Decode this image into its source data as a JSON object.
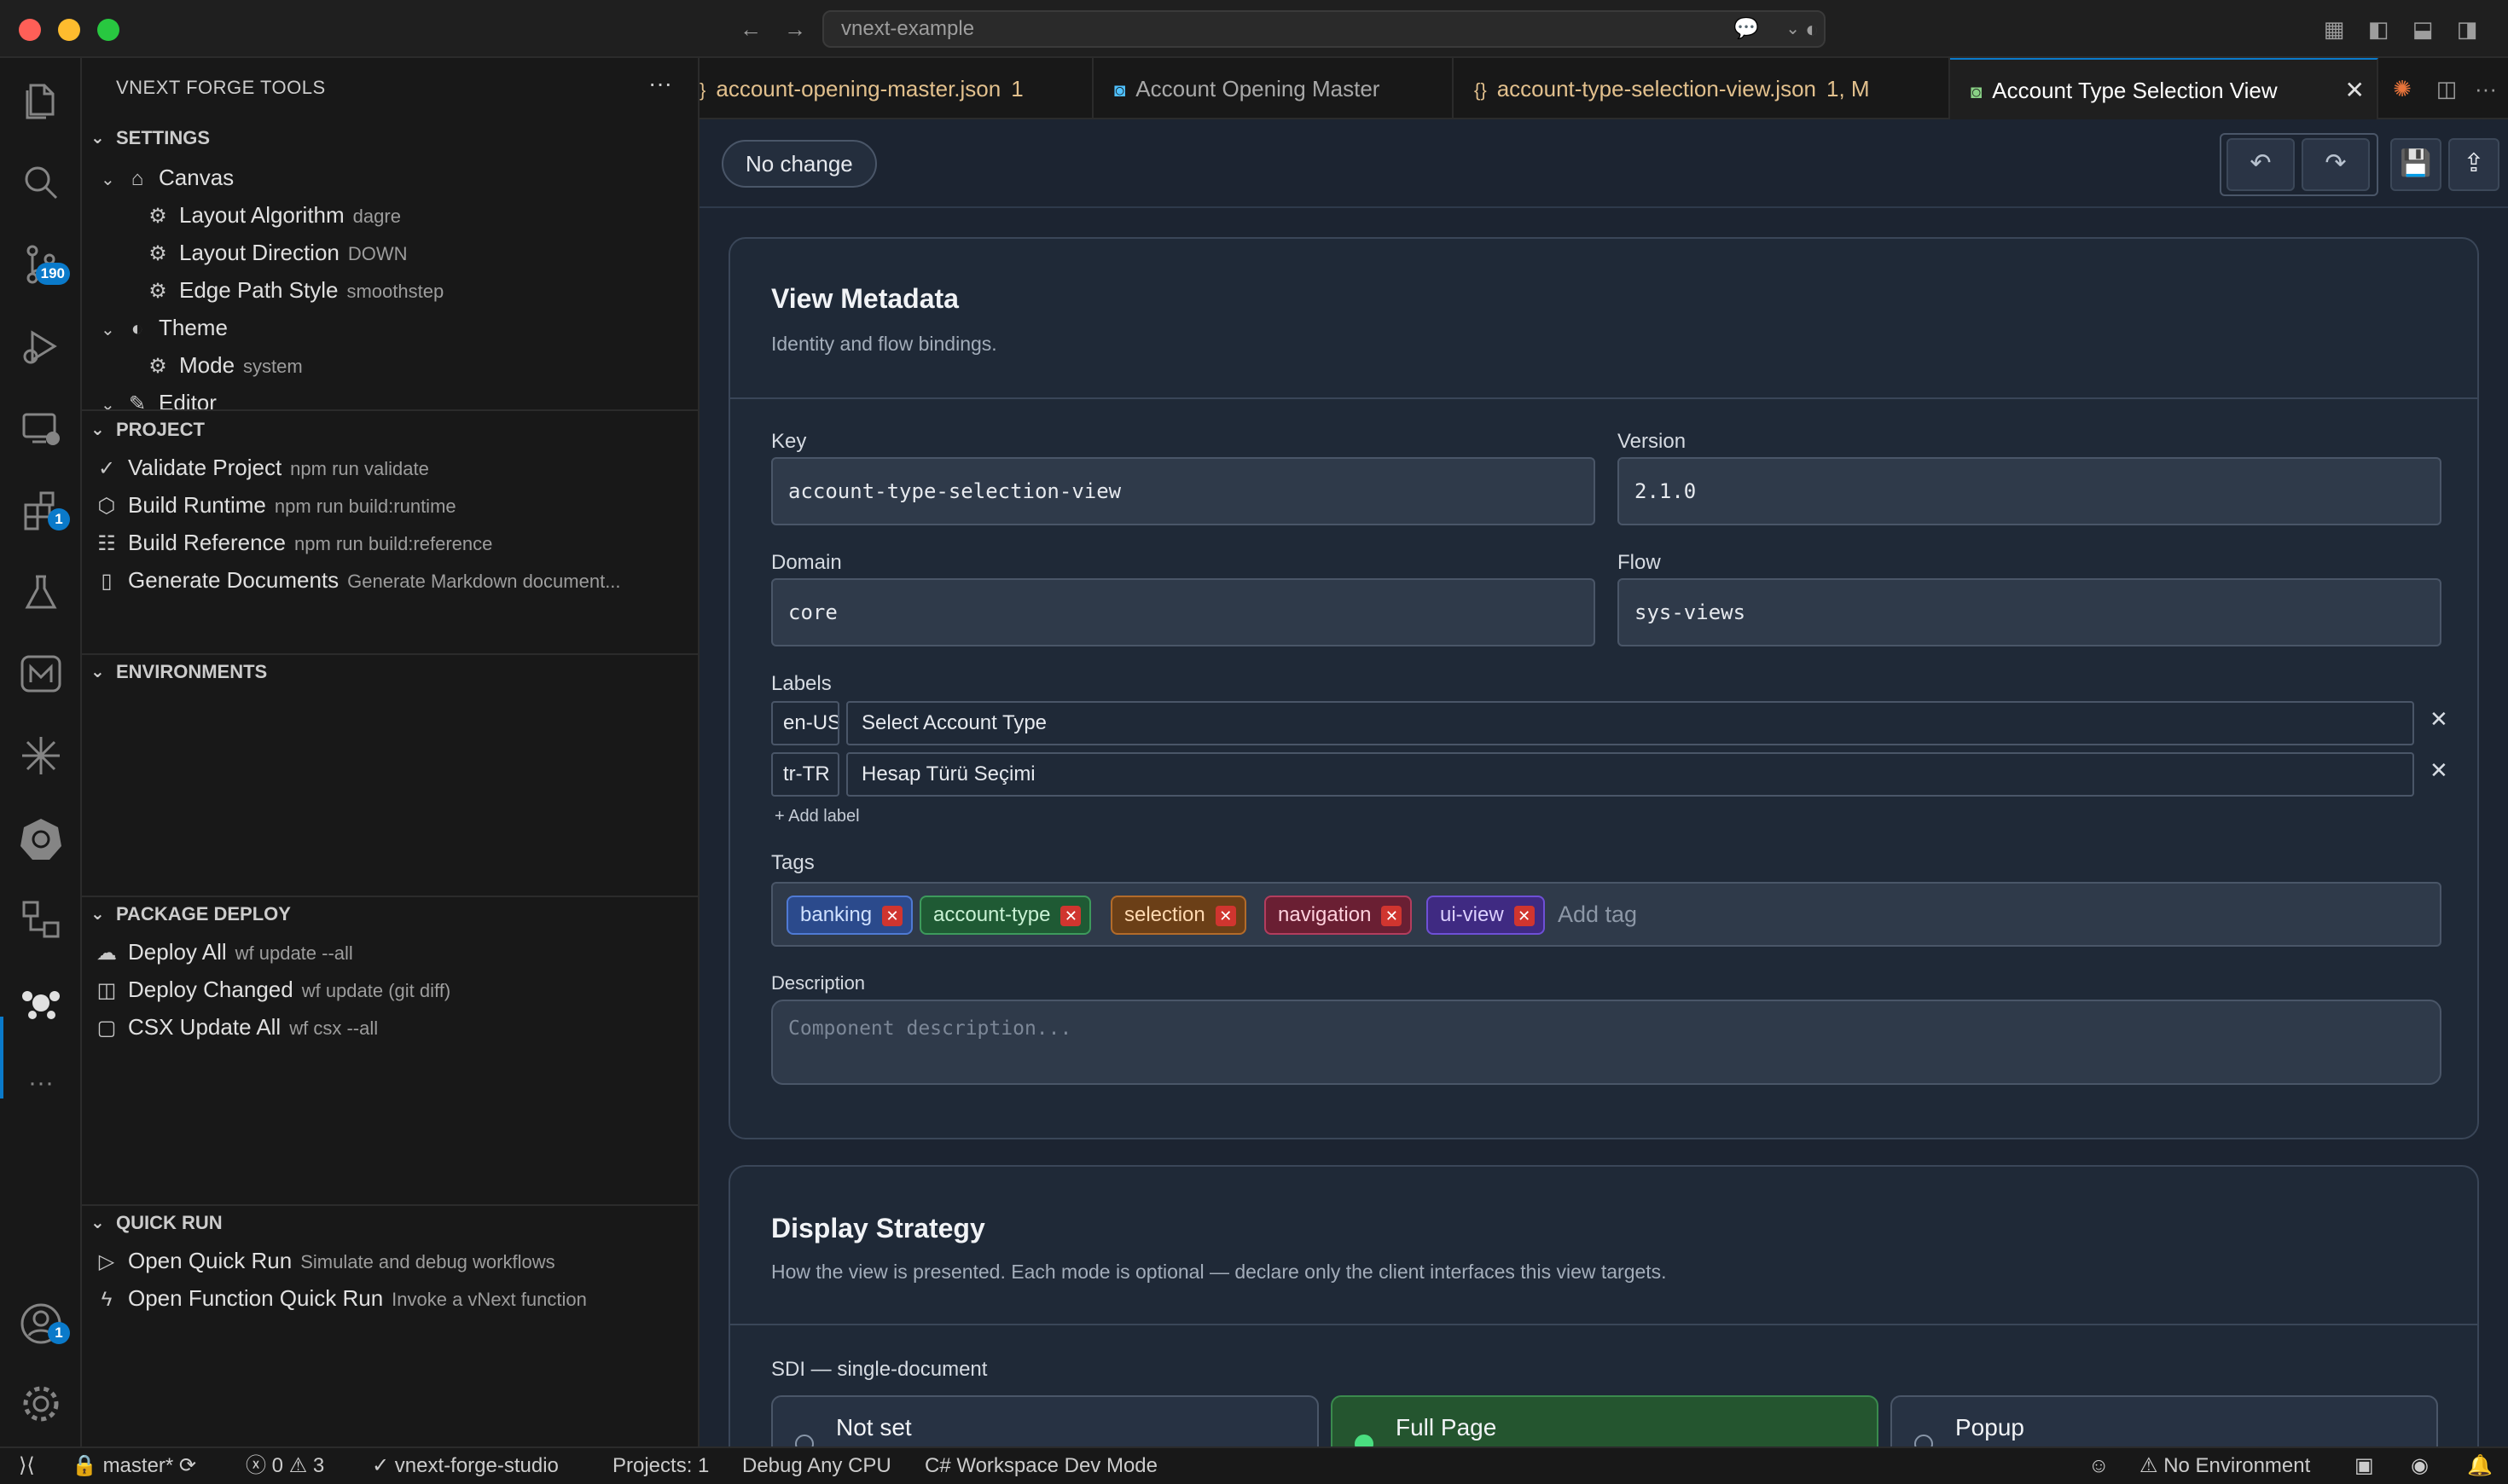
{
  "window": {
    "search_text": "vnext-example"
  },
  "colors": {
    "accent": "#0a7aca",
    "editor_bg": "#1c2431",
    "tag_banking": "#2b4a8c",
    "tag_account_type": "#1f5a34",
    "tag_selection": "#6b3f17",
    "tag_navigation": "#6a1f33",
    "tag_ui_view": "#3f2a82"
  },
  "activity_bar": {
    "items": [
      {
        "icon": "files-icon"
      },
      {
        "icon": "search-icon"
      },
      {
        "icon": "source-control-icon",
        "badge": "190"
      },
      {
        "icon": "run-debug-icon"
      },
      {
        "icon": "remote-explorer-icon"
      },
      {
        "icon": "extensions-icon",
        "badge": "1"
      },
      {
        "icon": "testing-icon"
      },
      {
        "icon": "markdown-icon"
      },
      {
        "icon": "sparkle-icon"
      },
      {
        "icon": "kubernetes-icon"
      },
      {
        "icon": "flow-icon"
      },
      {
        "icon": "vnext-forge-icon"
      },
      {
        "icon": "more-icon"
      }
    ],
    "accounts_badge": "1"
  },
  "sidebar": {
    "title": "VNEXT FORGE TOOLS",
    "more": "···",
    "settings": {
      "header": "SETTINGS",
      "canvas": "Canvas",
      "layout_algorithm": {
        "label": "Layout Algorithm",
        "value": "dagre"
      },
      "layout_direction": {
        "label": "Layout Direction",
        "value": "DOWN"
      },
      "edge_path_style": {
        "label": "Edge Path Style",
        "value": "smoothstep"
      },
      "theme": "Theme",
      "mode": {
        "label": "Mode",
        "value": "system"
      },
      "editor": "Editor"
    },
    "project": {
      "header": "PROJECT",
      "items": [
        {
          "label": "Validate Project",
          "desc": "npm run validate",
          "icon": "check-all-icon"
        },
        {
          "label": "Build Runtime",
          "desc": "npm run build:runtime",
          "icon": "package-icon"
        },
        {
          "label": "Build Reference",
          "desc": "npm run build:reference",
          "icon": "references-icon"
        },
        {
          "label": "Generate Documents",
          "desc": "Generate Markdown document...",
          "icon": "book-icon"
        }
      ]
    },
    "environments": {
      "header": "ENVIRONMENTS"
    },
    "package_deploy": {
      "header": "PACKAGE DEPLOY",
      "items": [
        {
          "label": "Deploy All",
          "desc": "wf update --all",
          "icon": "cloud-upload-icon"
        },
        {
          "label": "Deploy Changed",
          "desc": "wf update (git diff)",
          "icon": "diff-icon"
        },
        {
          "label": "CSX Update All",
          "desc": "wf csx --all",
          "icon": "file-code-icon"
        }
      ]
    },
    "quick_run": {
      "header": "QUICK RUN",
      "items": [
        {
          "label": "Open Quick Run",
          "desc": "Simulate and debug workflows",
          "icon": "play-icon"
        },
        {
          "label": "Open Function Quick Run",
          "desc": "Invoke a vNext function",
          "icon": "zap-icon"
        }
      ]
    }
  },
  "tabs": [
    {
      "label": "account-opening-master.json",
      "suffix": "1",
      "icon": "json-icon"
    },
    {
      "label": "Account Opening Master",
      "icon": "vnext-doc-icon"
    },
    {
      "label": "account-type-selection-view.json",
      "suffix": "1, M",
      "icon": "json-icon"
    },
    {
      "label": "Account Type Selection View",
      "icon": "vnext-view-icon",
      "active": true
    }
  ],
  "editor": {
    "status_pill": "No change",
    "view_metadata": {
      "title": "View Metadata",
      "subtitle": "Identity and flow bindings.",
      "key_label": "Key",
      "key_value": "account-type-selection-view",
      "version_label": "Version",
      "version_value": "2.1.0",
      "domain_label": "Domain",
      "domain_value": "core",
      "flow_label": "Flow",
      "flow_value": "sys-views",
      "labels_label": "Labels",
      "labels": [
        {
          "lang": "en-US",
          "value": "Select Account Type"
        },
        {
          "lang": "tr-TR",
          "value": "Hesap Türü Seçimi"
        }
      ],
      "add_label": "+ Add label",
      "tags_label": "Tags",
      "tags": [
        "banking",
        "account-type",
        "selection",
        "navigation",
        "ui-view"
      ],
      "add_tag_placeholder": "Add tag",
      "description_label": "Description",
      "description_placeholder": "Component description..."
    },
    "display_strategy": {
      "title": "Display Strategy",
      "subtitle": "How the view is presented. Each mode is optional — declare only the client interfaces this view targets.",
      "sdi_label": "SDI — single-document",
      "options": [
        {
          "title": "Not set",
          "selected": false
        },
        {
          "title": "Full Page",
          "selected": true
        },
        {
          "title": "Popup",
          "selected": false
        }
      ]
    }
  },
  "statusbar": {
    "branch": "master*",
    "errors": "0",
    "warnings": "3",
    "workspace": "vnext-forge-studio",
    "projects": "Projects: 1",
    "debug": "Debug Any CPU",
    "mode": "C# Workspace Dev Mode",
    "environment": "No Environment"
  }
}
